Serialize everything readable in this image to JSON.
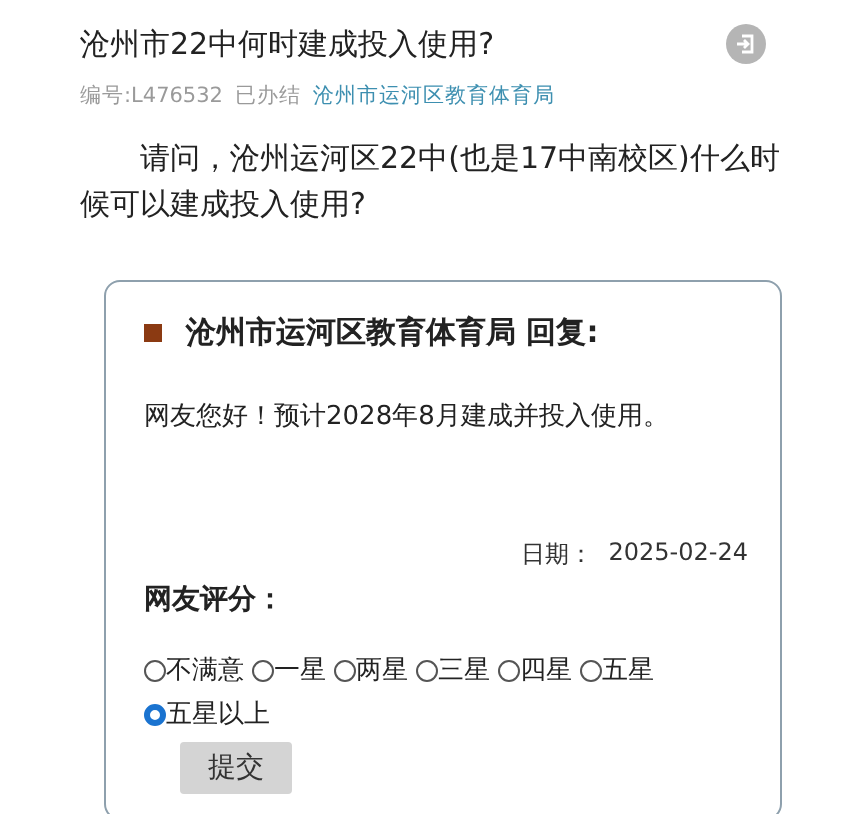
{
  "question": {
    "title": "沧州市22中何时建成投入使用?",
    "number": "编号:L476532",
    "status": "已办结",
    "department": "沧州市运河区教育体育局",
    "body": "请问，沧州运河区22中(也是17中南校区)什么时候可以建成投入使用?"
  },
  "reply": {
    "heading": "沧州市运河区教育体育局 回复:",
    "text": "网友您好！预计2028年8月建成并投入使用。",
    "date_label": "日期：",
    "date": "2025-02-24"
  },
  "rating": {
    "label": "网友评分：",
    "options": [
      {
        "label": "不满意",
        "selected": false
      },
      {
        "label": "一星",
        "selected": false
      },
      {
        "label": "两星",
        "selected": false
      },
      {
        "label": "三星",
        "selected": false
      },
      {
        "label": "四星",
        "selected": false
      },
      {
        "label": "五星",
        "selected": false
      },
      {
        "label": "五星以上",
        "selected": true
      }
    ],
    "submit": "提交"
  }
}
